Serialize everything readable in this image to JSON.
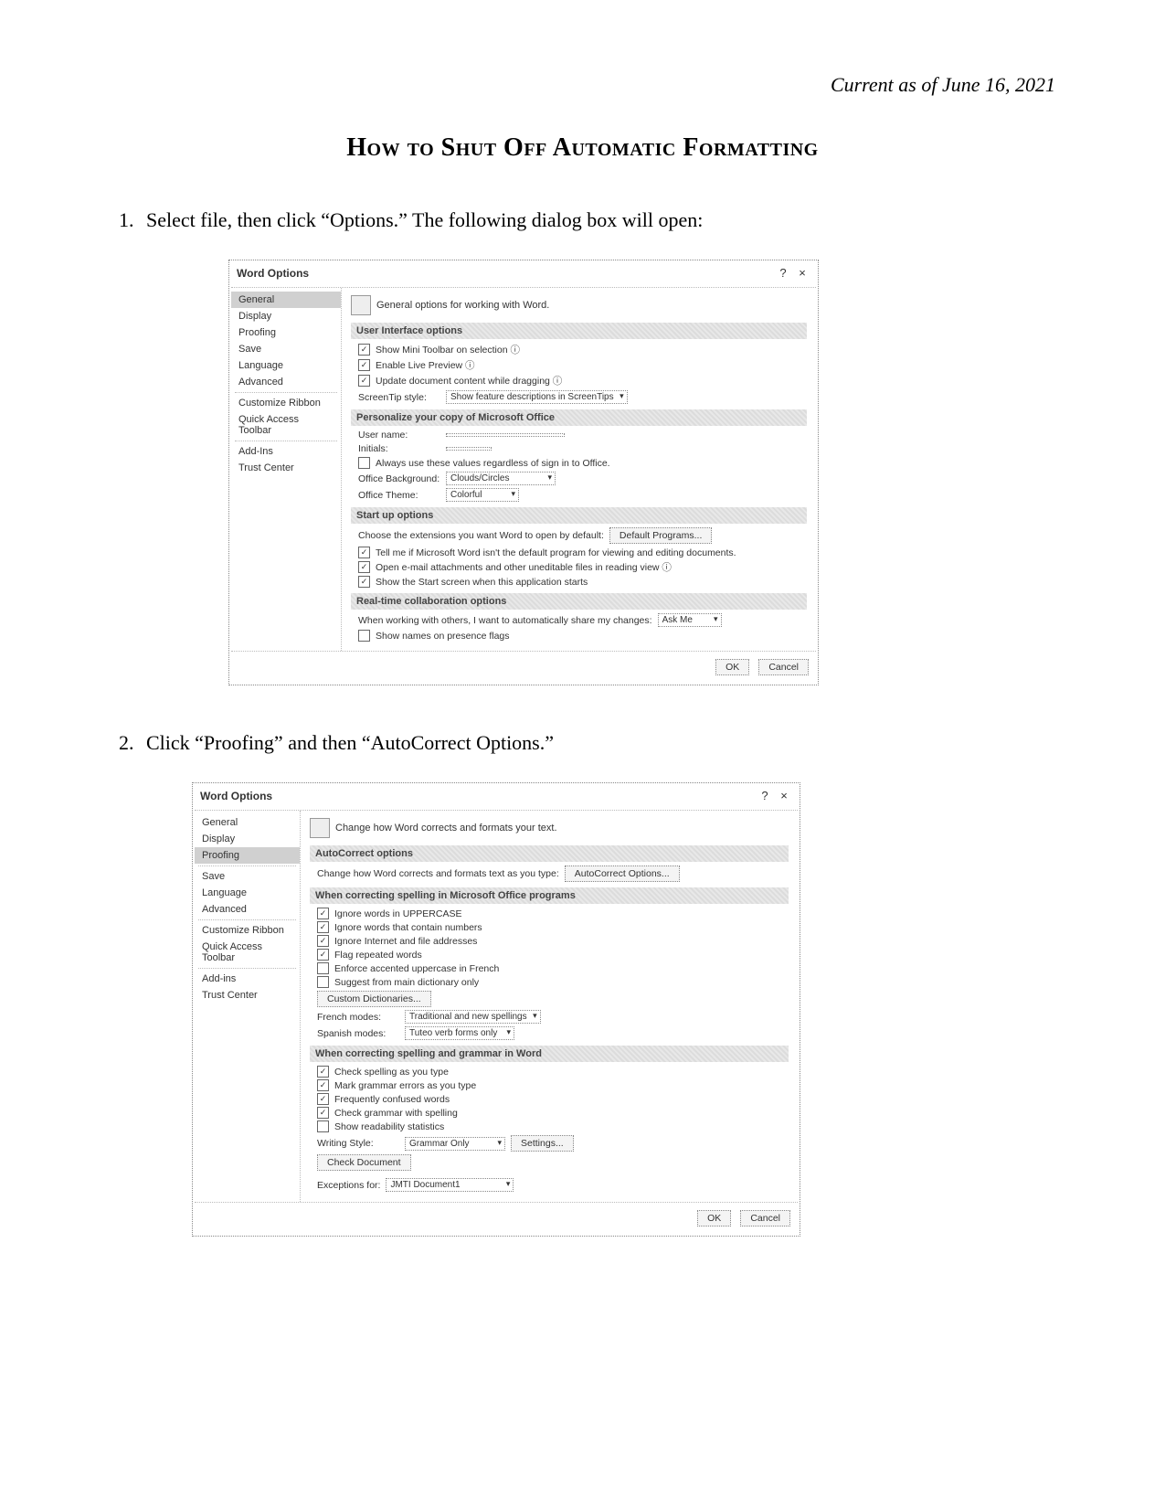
{
  "date_line": "Current as of June 16, 2021",
  "title": "How to Shut Off Automatic Formatting",
  "steps": {
    "s1": "Select file, then click “Options.”  The following dialog box will open:",
    "s2": "Click “Proofing” and then “AutoCorrect Options.”"
  },
  "dialog1": {
    "title": "Word Options",
    "help": "?",
    "close": "×",
    "sidebar": [
      "General",
      "Display",
      "Proofing",
      "Save",
      "Language",
      "Advanced",
      "Customize Ribbon",
      "Quick Access Toolbar",
      "Add-Ins",
      "Trust Center"
    ],
    "selected_index": 0,
    "head": "General options for working with Word.",
    "sec_ui": "User Interface options",
    "ui_opts": {
      "show_mini": "Show Mini Toolbar on selection ⓘ",
      "live_preview": "Enable Live Preview ⓘ",
      "update_drag": "Update document content while dragging ⓘ",
      "screentip_label": "ScreenTip style:",
      "screentip_value": "Show feature descriptions in ScreenTips"
    },
    "sec_personal": "Personalize your copy of Microsoft Office",
    "personal": {
      "username_label": "User name:",
      "username_value": "",
      "initials_label": "Initials:",
      "initials_value": "",
      "always_use": "Always use these values regardless of sign in to Office.",
      "bg_label": "Office Background:",
      "bg_value": "Clouds/Circles",
      "theme_label": "Office Theme:",
      "theme_value": "Colorful"
    },
    "sec_startup": "Start up options",
    "startup": {
      "choose_ext": "Choose the extensions you want Word to open by default:",
      "default_btn": "Default Programs...",
      "tell_me": "Tell me if Microsoft Word isn't the default program for viewing and editing documents.",
      "open_email": "Open e-mail attachments and other uneditable files in reading view ⓘ",
      "start_screen": "Show the Start screen when this application starts"
    },
    "sec_collab": "Real-time collaboration options",
    "collab": {
      "presence": "When working with others, I want to automatically share my changes:",
      "presence_value": "Ask Me",
      "names": "Show names on presence flags"
    },
    "ok": "OK",
    "cancel": "Cancel"
  },
  "dialog2": {
    "title": "Word Options",
    "help": "?",
    "close": "×",
    "sidebar": [
      "General",
      "Display",
      "Proofing",
      "Save",
      "Language",
      "Advanced",
      "Customize Ribbon",
      "Quick Access Toolbar",
      "Add-ins",
      "Trust Center"
    ],
    "selected_index": 2,
    "head": "Change how Word corrects and formats your text.",
    "sec_ac": "AutoCorrect options",
    "ac_text": "Change how Word corrects and formats text as you type:",
    "ac_btn": "AutoCorrect Options...",
    "sec_spell_office": "When correcting spelling in Microsoft Office programs",
    "spell_office": {
      "upper": "Ignore words in UPPERCASE",
      "numbers": "Ignore words that contain numbers",
      "internet": "Ignore Internet and file addresses",
      "repeated": "Flag repeated words",
      "french_upper": "Enforce accented uppercase in French",
      "main_dict": "Suggest from main dictionary only",
      "custom_btn": "Custom Dictionaries...",
      "french_label": "French modes:",
      "french_value": "Traditional and new spellings",
      "spanish_label": "Spanish modes:",
      "spanish_value": "Tuteo verb forms only"
    },
    "sec_spell_word": "When correcting spelling and grammar in Word",
    "spell_word": {
      "check_spell": "Check spelling as you type",
      "mark_grammar": "Mark grammar errors as you type",
      "confused": "Frequently confused words",
      "grammar_spell": "Check grammar with spelling",
      "readability": "Show readability statistics",
      "style_label": "Writing Style:",
      "style_value": "Grammar Only",
      "settings_btn": "Settings...",
      "recheck_btn": "Check Document"
    },
    "exceptions_label": "Exceptions for:",
    "exceptions_value": "JMTI  Document1",
    "ok": "OK",
    "cancel": "Cancel"
  }
}
